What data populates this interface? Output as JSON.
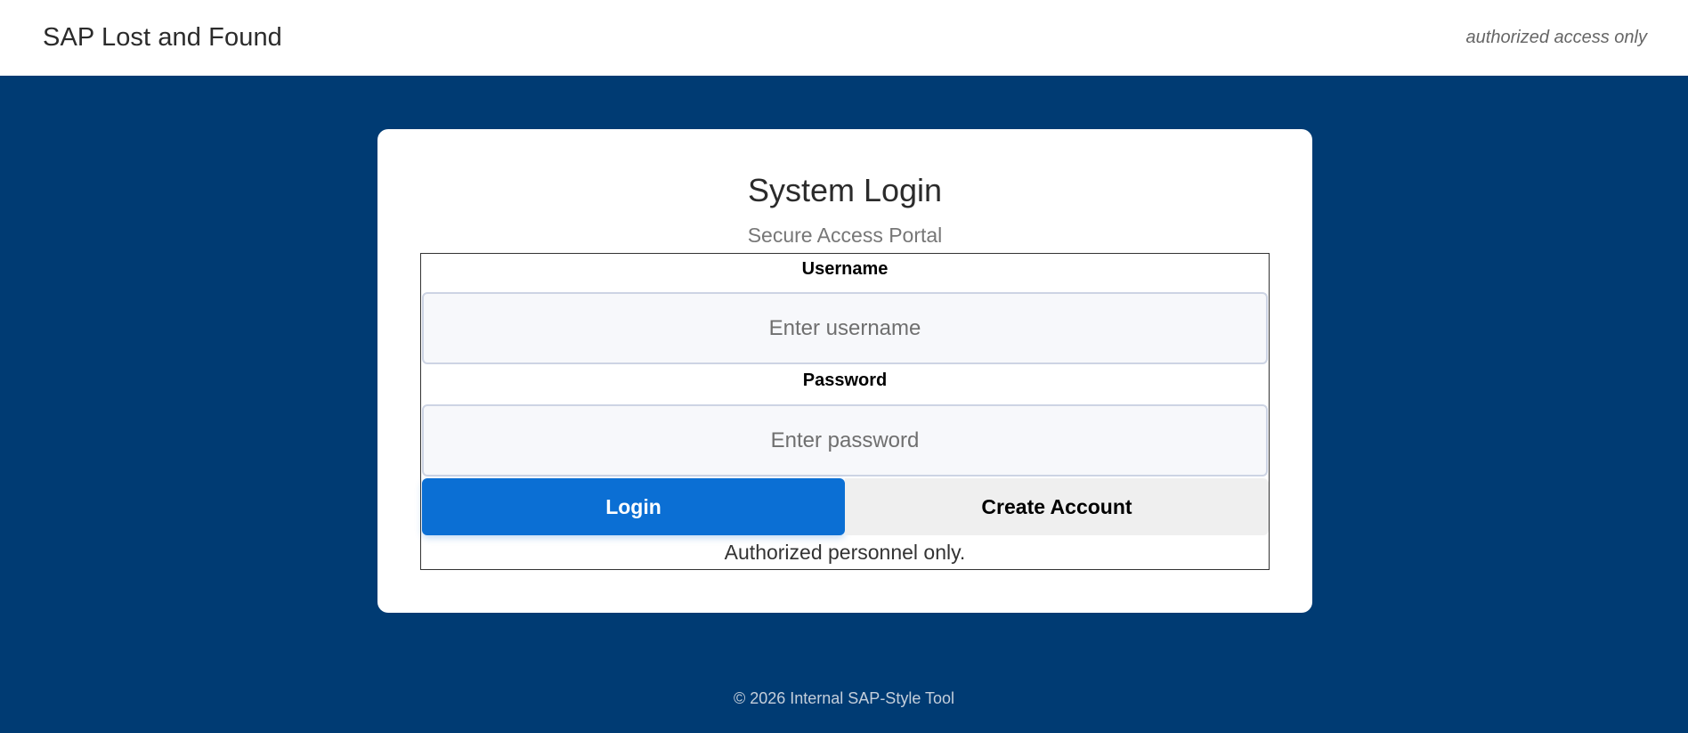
{
  "header": {
    "app_title": "SAP Lost and Found",
    "access_note": "authorized access only"
  },
  "login_card": {
    "title": "System Login",
    "subtitle": "Secure Access Portal",
    "username": {
      "label": "Username",
      "placeholder": "Enter username",
      "value": ""
    },
    "password": {
      "label": "Password",
      "placeholder": "Enter password",
      "value": ""
    },
    "login_button_label": "Login",
    "create_account_button_label": "Create Account",
    "authorized_note": "Authorized personnel only."
  },
  "footer": {
    "copyright": "© 2026 Internal SAP-Style Tool"
  },
  "colors": {
    "page_background": "#003b73",
    "primary_button": "#0b6fd4",
    "secondary_button": "#efefef",
    "input_background": "#f7f8fb"
  }
}
